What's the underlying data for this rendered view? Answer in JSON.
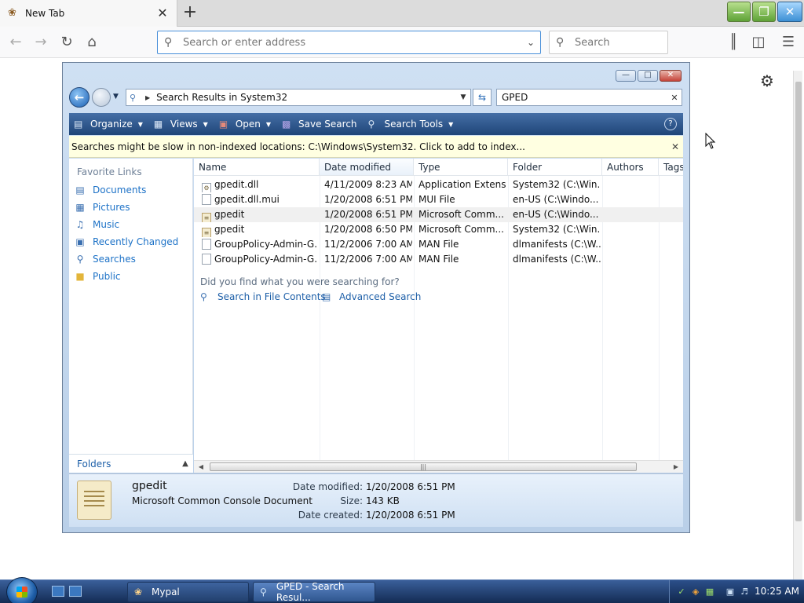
{
  "browser": {
    "tab_title": "New Tab",
    "url_placeholder": "Search or enter address",
    "search_placeholder": "Search"
  },
  "explorer": {
    "address": "Search Results in System32",
    "search_value": "GPED",
    "toolbar": {
      "organize": "Organize",
      "views": "Views",
      "open": "Open",
      "save_search": "Save Search",
      "search_tools": "Search Tools",
      "help": "?"
    },
    "infobar_message": "Searches might be slow in non-indexed locations: C:\\Windows\\System32. Click to add to index...",
    "nav": {
      "header": "Favorite Links",
      "links": [
        "Documents",
        "Pictures",
        "Music",
        "Recently Changed",
        "Searches",
        "Public"
      ],
      "folders_label": "Folders"
    },
    "columns": [
      "Name",
      "Date modified",
      "Type",
      "Folder",
      "Authors",
      "Tags"
    ],
    "rows": [
      {
        "name": "gpedit.dll",
        "date": "4/11/2009 8:23 AM",
        "type": "Application Extens...",
        "folder": "System32 (C:\\Win..."
      },
      {
        "name": "gpedit.dll.mui",
        "date": "1/20/2008 6:51 PM",
        "type": "MUI File",
        "folder": "en-US (C:\\Windo..."
      },
      {
        "name": "gpedit",
        "date": "1/20/2008 6:51 PM",
        "type": "Microsoft Comm...",
        "folder": "en-US (C:\\Windo..."
      },
      {
        "name": "gpedit",
        "date": "1/20/2008 6:50 PM",
        "type": "Microsoft Comm...",
        "folder": "System32 (C:\\Win..."
      },
      {
        "name": "GroupPolicy-Admin-G...",
        "date": "11/2/2006 7:00 AM",
        "type": "MAN File",
        "folder": "dlmanifests (C:\\W..."
      },
      {
        "name": "GroupPolicy-Admin-G...",
        "date": "11/2/2006 7:00 AM",
        "type": "MAN File",
        "folder": "dlmanifests (C:\\W..."
      }
    ],
    "find_question": "Did you find what you were searching for?",
    "search_in_contents": "Search in File Contents",
    "advanced_search": "Advanced Search",
    "details": {
      "name": "gpedit",
      "type": "Microsoft Common Console Document",
      "date_modified_label": "Date modified:",
      "date_modified": "1/20/2008 6:51 PM",
      "size_label": "Size:",
      "size": "143 KB",
      "date_created_label": "Date created:",
      "date_created": "1/20/2008 6:51 PM"
    }
  },
  "taskbar": {
    "tasks": [
      "Mypal",
      "GPED - Search Resul..."
    ],
    "clock": "10:25 AM"
  },
  "colors": {
    "link_blue": "#1d72c7",
    "toolbar_blue": "#1f4578",
    "infobar_yellow": "#ffffe1"
  }
}
